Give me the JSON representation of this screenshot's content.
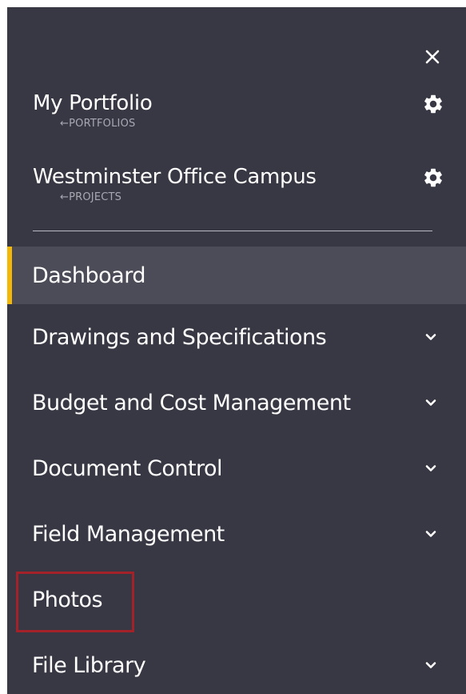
{
  "header": {
    "close_icon": "close-icon"
  },
  "portfolio": {
    "title": "My Portfolio",
    "back_link": "←PORTFOLIOS",
    "settings_icon": "gear-icon"
  },
  "project": {
    "title": "Westminster Office Campus",
    "back_link": "←PROJECTS",
    "settings_icon": "gear-icon"
  },
  "nav": {
    "items": [
      {
        "label": "Dashboard",
        "active": true,
        "expandable": false
      },
      {
        "label": "Drawings and Specifications",
        "active": false,
        "expandable": true
      },
      {
        "label": "Budget and Cost Management",
        "active": false,
        "expandable": true
      },
      {
        "label": "Document Control",
        "active": false,
        "expandable": true
      },
      {
        "label": "Field Management",
        "active": false,
        "expandable": true
      },
      {
        "label": "Photos",
        "active": false,
        "expandable": false,
        "highlighted": true
      },
      {
        "label": "File Library",
        "active": false,
        "expandable": true
      }
    ]
  },
  "colors": {
    "panel_bg": "#383744",
    "active_bg": "#4c4b58",
    "active_accent": "#f2b707",
    "highlight_border": "#a3222a"
  }
}
